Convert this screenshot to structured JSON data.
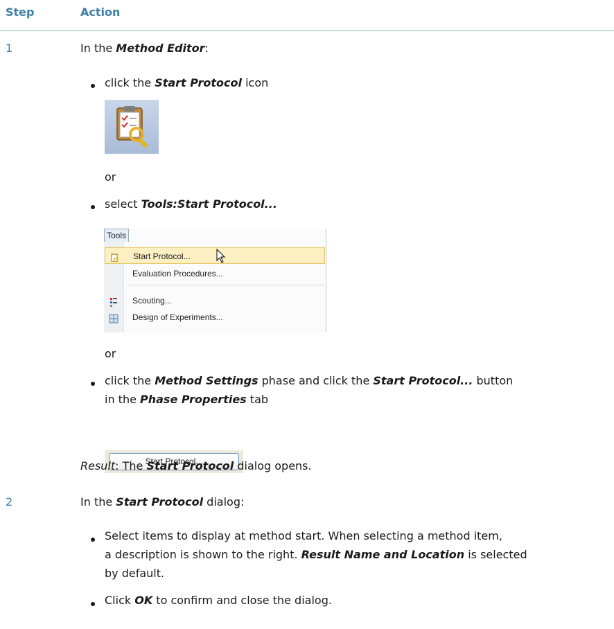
{
  "header": {
    "step": "Step",
    "action": "Action"
  },
  "step1": {
    "number": "1",
    "intro_prefix": "In the ",
    "intro_em": "Method Editor",
    "intro_suffix": ":",
    "bullet1": {
      "prefix": "click the ",
      "em": "Start Protocol",
      "suffix": " icon"
    },
    "or1": "or",
    "bullet2": {
      "prefix": "select ",
      "em": "Tools:Start Protocol..."
    },
    "menu": {
      "tab": "Tools",
      "items": [
        "Start Protocol...",
        "Evaluation Procedures...",
        "Scouting...",
        "Design of Experiments..."
      ]
    },
    "or2": "or",
    "bullet3": {
      "line1_prefix": "click the ",
      "line1_em1": "Method Settings",
      "line1_mid": " phase and click the ",
      "line1_em2": "Start Protocol...",
      "line1_suffix": " button",
      "line2_prefix": "in the ",
      "line2_em": "Phase Properties",
      "line2_suffix": " tab"
    },
    "button_label": "Start Protocol...",
    "result_em": "Result",
    "result_mid": ": The ",
    "result_em2": "Start Protocol",
    "result_suffix": " dialog opens."
  },
  "step2": {
    "number": "2",
    "intro_prefix": "In the ",
    "intro_em": "Start Protocol",
    "intro_suffix": " dialog:",
    "bullet1": {
      "line1": "Select items to display at method start. When selecting a method item,",
      "line2": "a description is shown to the right. ",
      "line2_em": "Result Name and Location",
      "line2_suffix": " is selected",
      "line3": "by default."
    },
    "bullet2": {
      "prefix": "Click ",
      "em": "OK",
      "suffix": " to confirm and close the dialog."
    }
  }
}
